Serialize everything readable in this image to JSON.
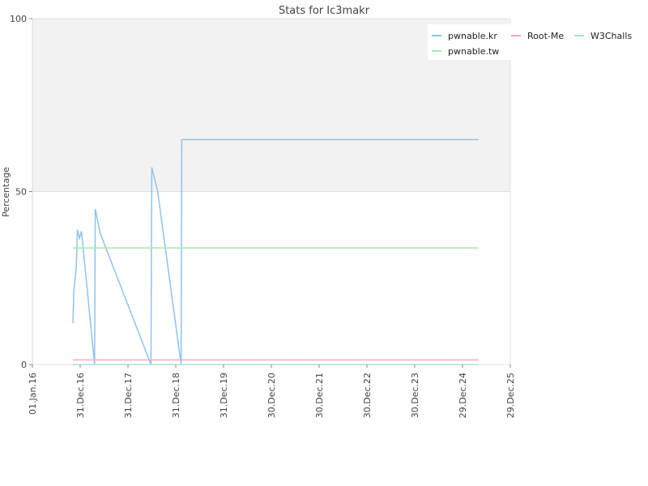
{
  "chart_data": {
    "type": "line",
    "title": "Stats for Ic3makr",
    "ylabel": "Percentage",
    "xlabel": "",
    "ylim": [
      0,
      100
    ],
    "y_ticks": [
      "0",
      "50",
      "100"
    ],
    "x_range": [
      "2016-01-01",
      "2025-12-29"
    ],
    "x_ticks": [
      {
        "date": "2016-01-01",
        "label": "01.Jan.16"
      },
      {
        "date": "2016-12-31",
        "label": "31.Dec.16"
      },
      {
        "date": "2017-12-31",
        "label": "31.Dec.17"
      },
      {
        "date": "2018-12-31",
        "label": "31.Dec.18"
      },
      {
        "date": "2019-12-31",
        "label": "31.Dec.19"
      },
      {
        "date": "2020-12-30",
        "label": "30.Dec.20"
      },
      {
        "date": "2021-12-30",
        "label": "30.Dec.21"
      },
      {
        "date": "2022-12-30",
        "label": "30.Dec.22"
      },
      {
        "date": "2023-12-30",
        "label": "30.Dec.23"
      },
      {
        "date": "2024-12-29",
        "label": "29.Dec.24"
      },
      {
        "date": "2025-12-29",
        "label": "29.Dec.25"
      }
    ],
    "grid": true,
    "legend_position": "top-right",
    "series": [
      {
        "name": "pwnable.kr",
        "color": "#8ec3f0",
        "points": [
          [
            "2016-11-06",
            12
          ],
          [
            "2016-11-12",
            21
          ],
          [
            "2016-12-01",
            28
          ],
          [
            "2016-12-10",
            39
          ],
          [
            "2016-12-25",
            36.5
          ],
          [
            "2017-01-10",
            38.5
          ],
          [
            "2017-04-20",
            0
          ],
          [
            "2017-04-25",
            45
          ],
          [
            "2017-06-01",
            38
          ],
          [
            "2018-06-25",
            0
          ],
          [
            "2018-07-01",
            57
          ],
          [
            "2018-08-15",
            50
          ],
          [
            "2019-02-10",
            0
          ],
          [
            "2019-02-15",
            65
          ],
          [
            "2025-05-01",
            65
          ]
        ]
      },
      {
        "name": "Root-Me",
        "color": "#f6a9c8",
        "points": [
          [
            "2016-11-06",
            1.3
          ],
          [
            "2025-05-01",
            1.3
          ]
        ]
      },
      {
        "name": "W3Challs",
        "color": "#a8e2d2",
        "points": [
          [
            "2016-11-06",
            0
          ],
          [
            "2025-05-01",
            0
          ]
        ]
      },
      {
        "name": "pwnable.tw",
        "color": "#a9e8a8",
        "points": [
          [
            "2016-11-06",
            33.7
          ],
          [
            "2025-05-01",
            33.7
          ]
        ]
      }
    ]
  }
}
